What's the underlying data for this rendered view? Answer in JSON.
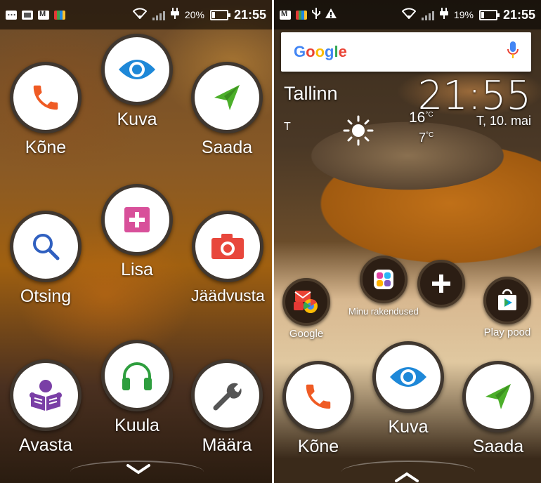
{
  "left_screen": {
    "status": {
      "battery": "20%",
      "time": "21:55"
    },
    "apps": [
      {
        "label": "Kõne"
      },
      {
        "label": "Kuva"
      },
      {
        "label": "Saada"
      },
      {
        "label": "Otsing"
      },
      {
        "label": "Lisa"
      },
      {
        "label": "Jäädvusta"
      },
      {
        "label": "Avasta"
      },
      {
        "label": "Kuula"
      },
      {
        "label": "Määra"
      }
    ],
    "arrow": "down"
  },
  "right_screen": {
    "status": {
      "battery": "19%",
      "time": "21:55"
    },
    "search_logo": "Google",
    "weather": {
      "city": "Tallinn",
      "time": "21:55",
      "date": "T, 10. mai",
      "day": "T",
      "high": "16",
      "low": "7",
      "unit": "°C"
    },
    "shortcuts": [
      {
        "label": "Google"
      },
      {
        "label": "Minu rakendused"
      },
      {
        "label": ""
      },
      {
        "label": "Play pood"
      }
    ],
    "dock": [
      {
        "label": "Kõne"
      },
      {
        "label": "Kuva"
      },
      {
        "label": "Saada"
      }
    ],
    "arrow": "up"
  },
  "colors": {
    "phone": "#ef5b24",
    "eye": "#1e88d8",
    "send": "#4caf2a",
    "search": "#3060c0",
    "plus": "#d8509a",
    "camera": "#e8473c",
    "avasta": "#7a3fa6",
    "headphones": "#2e9e3e",
    "wrench": "#555555"
  }
}
